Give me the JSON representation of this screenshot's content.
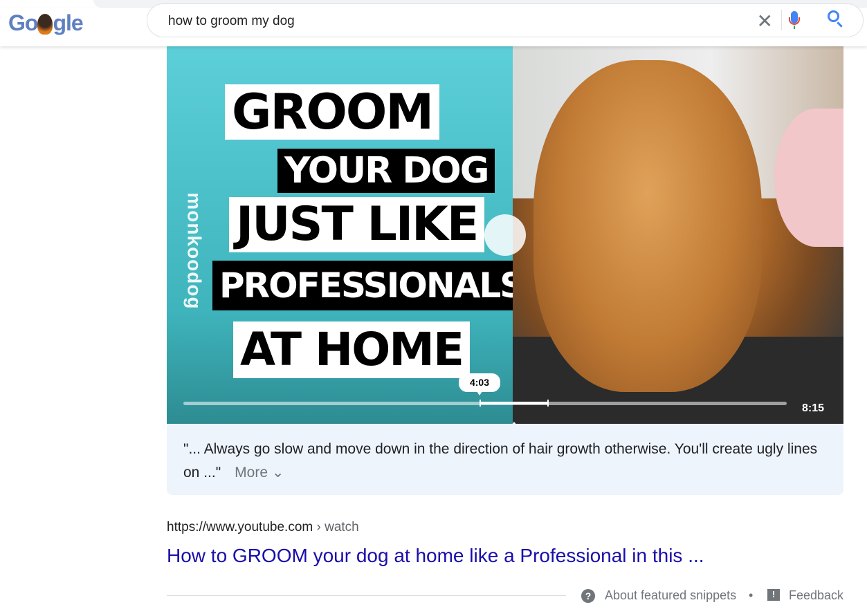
{
  "search": {
    "query": "how to groom my dog"
  },
  "logo": {
    "text_left": "Go",
    "text_right": "gle"
  },
  "video": {
    "thumbnail_lines": [
      "GROOM",
      "YOUR DOG",
      "JUST LIKE",
      "PROFESSIONALS",
      "AT HOME"
    ],
    "brand": "monkoodog",
    "tooltip_time": "4:03",
    "duration": "8:15",
    "progress_fraction": 0.49
  },
  "snippet": {
    "text": "\"... Always go slow and move down in the direction of hair growth otherwise. You'll create ugly lines on ...\"",
    "more_label": "More ⌄"
  },
  "result": {
    "url": "https://www.youtube.com",
    "breadcrumb": " › watch",
    "title": "How to GROOM your dog at home like a Professional in this ..."
  },
  "footer": {
    "about": "About featured snippets",
    "dot": "•",
    "feedback": "Feedback"
  },
  "colors": {
    "link": "#1a0dab",
    "snippet_bg": "#eef4fc"
  }
}
